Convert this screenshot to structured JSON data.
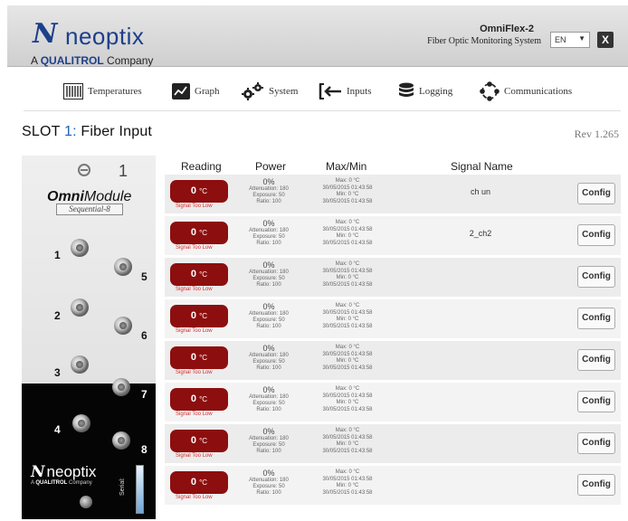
{
  "header": {
    "brand_mark": "N",
    "brand_name": "neoptix",
    "company_prefix": "A",
    "company_name": "QUALITROL",
    "company_suffix": "Company",
    "product_name": "OmniFlex-2",
    "product_desc": "Fiber Optic Monitoring System",
    "language": "EN",
    "close_label": "X",
    "colors": {
      "brand": "#1d3f8a",
      "accent": "#c62828"
    }
  },
  "nav": {
    "items": [
      {
        "label": "Temperatures",
        "icon": "thermometer-grid-icon"
      },
      {
        "label": "Graph",
        "icon": "graph-icon"
      },
      {
        "label": "System",
        "icon": "gears-icon"
      },
      {
        "label": "Inputs",
        "icon": "input-arrow-icon"
      },
      {
        "label": "Logging",
        "icon": "database-icon"
      },
      {
        "label": "Communications",
        "icon": "network-ring-icon"
      }
    ]
  },
  "page": {
    "slot_label": "SLOT",
    "slot_number": "1:",
    "slot_title": "Fiber Input",
    "revision": "Rev 1.265"
  },
  "module": {
    "slot_number": "1",
    "name_bold": "Omni",
    "name_rest": "Module",
    "variant": "Sequential-8",
    "ports": [
      "1",
      "2",
      "3",
      "4",
      "5",
      "6",
      "7",
      "8"
    ],
    "logo_mark": "N",
    "logo_text": "neoptix",
    "logo_sub_prefix": "A",
    "logo_sub_brand": "QUALITROL",
    "logo_sub_suffix": "Company",
    "serial_label": "Serial:"
  },
  "table": {
    "headers": {
      "reading": "Reading",
      "power": "Power",
      "maxmin": "Max/Min",
      "signal_name": "Signal Name"
    },
    "status_color": "#8d0e0e",
    "rows": [
      {
        "reading": "0",
        "unit": "°C",
        "status": "Signal Too Low",
        "power_pct": "0%",
        "attenuation": "Attenuation: 180",
        "exposure": "Exposure: 50",
        "ratio": "Ratio: 100",
        "max": "Max: 0 °C",
        "max_time": "30/05/2015 01:43:58",
        "min": "Min: 0 °C",
        "min_time": "30/05/2015 01:43:58",
        "signal_name": "ch un",
        "config": "Config"
      },
      {
        "reading": "0",
        "unit": "°C",
        "status": "Signal Too Low",
        "power_pct": "0%",
        "attenuation": "Attenuation: 180",
        "exposure": "Exposure: 50",
        "ratio": "Ratio: 100",
        "max": "Max: 0 °C",
        "max_time": "30/05/2015 01:43:58",
        "min": "Min: 0 °C",
        "min_time": "30/05/2015 01:43:58",
        "signal_name": "2_ch2",
        "config": "Config"
      },
      {
        "reading": "0",
        "unit": "°C",
        "status": "Signal Too Low",
        "power_pct": "0%",
        "attenuation": "Attenuation: 180",
        "exposure": "Exposure: 50",
        "ratio": "Ratio: 100",
        "max": "Max: 0 °C",
        "max_time": "30/05/2015 01:43:58",
        "min": "Min: 0 °C",
        "min_time": "30/05/2015 01:43:58",
        "signal_name": "",
        "config": "Config"
      },
      {
        "reading": "0",
        "unit": "°C",
        "status": "Signal Too Low",
        "power_pct": "0%",
        "attenuation": "Attenuation: 180",
        "exposure": "Exposure: 50",
        "ratio": "Ratio: 100",
        "max": "Max: 0 °C",
        "max_time": "30/05/2015 01:43:58",
        "min": "Min: 0 °C",
        "min_time": "30/05/2015 01:43:58",
        "signal_name": "",
        "config": "Config"
      },
      {
        "reading": "0",
        "unit": "°C",
        "status": "Signal Too Low",
        "power_pct": "0%",
        "attenuation": "Attenuation: 180",
        "exposure": "Exposure: 50",
        "ratio": "Ratio: 100",
        "max": "Max: 0 °C",
        "max_time": "30/05/2015 01:43:58",
        "min": "Min: 0 °C",
        "min_time": "30/05/2015 01:43:58",
        "signal_name": "",
        "config": "Config"
      },
      {
        "reading": "0",
        "unit": "°C",
        "status": "Signal Too Low",
        "power_pct": "0%",
        "attenuation": "Attenuation: 180",
        "exposure": "Exposure: 50",
        "ratio": "Ratio: 100",
        "max": "Max: 0 °C",
        "max_time": "30/05/2015 01:43:58",
        "min": "Min: 0 °C",
        "min_time": "30/05/2015 01:43:58",
        "signal_name": "",
        "config": "Config"
      },
      {
        "reading": "0",
        "unit": "°C",
        "status": "Signal Too Low",
        "power_pct": "0%",
        "attenuation": "Attenuation: 180",
        "exposure": "Exposure: 50",
        "ratio": "Ratio: 100",
        "max": "Max: 0 °C",
        "max_time": "30/05/2015 01:43:58",
        "min": "Min: 0 °C",
        "min_time": "30/05/2015 01:43:58",
        "signal_name": "",
        "config": "Config"
      },
      {
        "reading": "0",
        "unit": "°C",
        "status": "Signal Too Low",
        "power_pct": "0%",
        "attenuation": "Attenuation: 180",
        "exposure": "Exposure: 50",
        "ratio": "Ratio: 100",
        "max": "Max: 0 °C",
        "max_time": "30/05/2015 01:43:58",
        "min": "Min: 0 °C",
        "min_time": "30/05/2015 01:43:58",
        "signal_name": "",
        "config": "Config"
      }
    ]
  }
}
